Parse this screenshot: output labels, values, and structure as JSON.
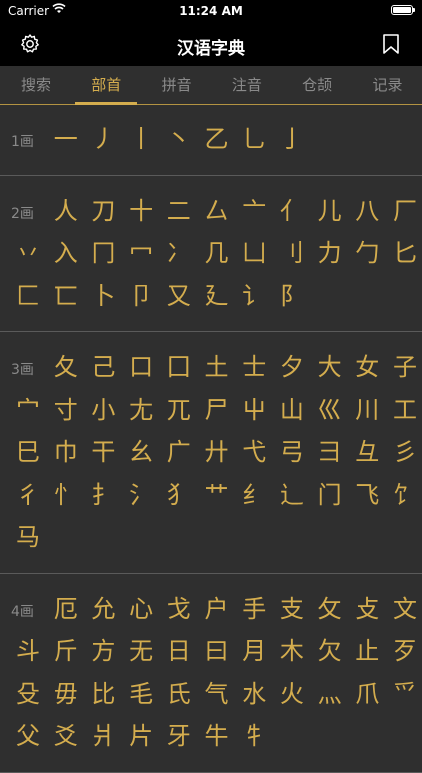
{
  "status": {
    "carrier": "Carrier",
    "time": "11:24 AM"
  },
  "nav": {
    "title": "汉语字典"
  },
  "tabs": [
    {
      "label": "搜索",
      "active": false
    },
    {
      "label": "部首",
      "active": true
    },
    {
      "label": "拼音",
      "active": false
    },
    {
      "label": "注音",
      "active": false
    },
    {
      "label": "仓颉",
      "active": false
    },
    {
      "label": "记录",
      "active": false
    }
  ],
  "sections": [
    {
      "label": "1画",
      "radicals": [
        "一",
        "丿",
        "丨",
        "丶",
        "乙",
        "乚",
        "亅"
      ]
    },
    {
      "label": "2画",
      "radicals": [
        "人",
        "刀",
        "十",
        "二",
        "厶",
        "亠",
        "亻",
        "儿",
        "八",
        "厂",
        "丷",
        "入",
        "冂",
        "冖",
        "冫",
        "几",
        "凵",
        "刂",
        "力",
        "勹",
        "匕",
        "匚",
        "匸",
        "卜",
        "卩",
        "又",
        "廴",
        "讠",
        "阝"
      ]
    },
    {
      "label": "3画",
      "radicals": [
        "夂",
        "己",
        "口",
        "囗",
        "土",
        "士",
        "夕",
        "大",
        "女",
        "子",
        "宀",
        "寸",
        "小",
        "尢",
        "兀",
        "尸",
        "屮",
        "山",
        "巛",
        "川",
        "工",
        "巳",
        "巾",
        "干",
        "幺",
        "广",
        "廾",
        "弋",
        "弓",
        "彐",
        "彑",
        "彡",
        "彳",
        "忄",
        "扌",
        "氵",
        "犭",
        "艹",
        "纟",
        "辶",
        "门",
        "飞",
        "饣",
        "马"
      ]
    },
    {
      "label": "4画",
      "radicals": [
        "厄",
        "允",
        "心",
        "戈",
        "户",
        "手",
        "支",
        "攵",
        "攴",
        "文",
        "斗",
        "斤",
        "方",
        "无",
        "日",
        "曰",
        "月",
        "木",
        "欠",
        "止",
        "歹",
        "殳",
        "毋",
        "比",
        "毛",
        "氏",
        "气",
        "水",
        "火",
        "灬",
        "爪",
        "爫",
        "父",
        "爻",
        "爿",
        "片",
        "牙",
        "牛",
        "牜"
      ]
    }
  ]
}
